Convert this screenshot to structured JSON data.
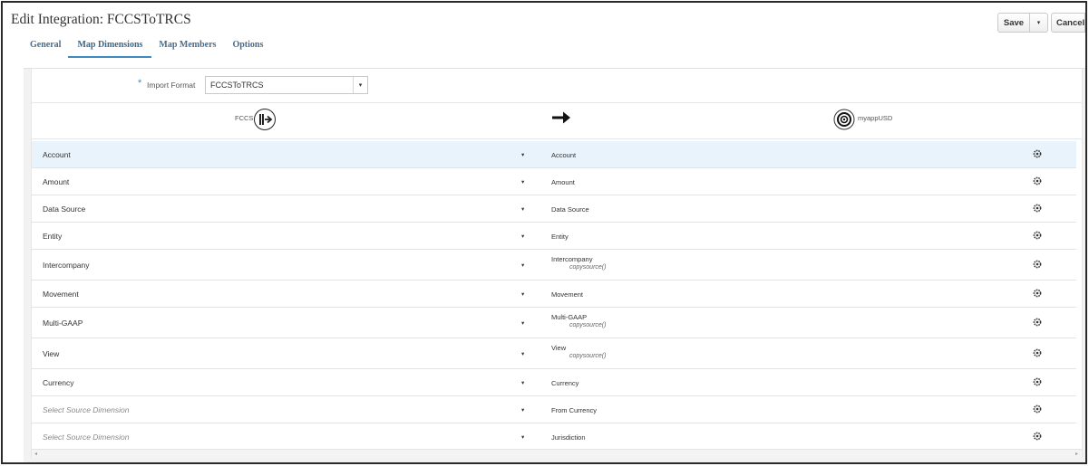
{
  "page": {
    "title": "Edit Integration: FCCSToTRCS"
  },
  "toolbar": {
    "save_label": "Save",
    "cancel_label": "Cancel",
    "dropdown_glyph": "▾"
  },
  "tabs": [
    {
      "label": "General",
      "active": false
    },
    {
      "label": "Map Dimensions",
      "active": true
    },
    {
      "label": "Map Members",
      "active": false
    },
    {
      "label": "Options",
      "active": false
    }
  ],
  "import_format": {
    "required_mark": "*",
    "label": "Import Format",
    "value": "FCCSToTRCS",
    "caret": "▾"
  },
  "mapping_header": {
    "source_label": "FCCS",
    "target_label": "myappUSD"
  },
  "row_caret": "▾",
  "rows": [
    {
      "source": "Account",
      "source_placeholder": false,
      "target": "Account",
      "expression": "",
      "selected": true
    },
    {
      "source": "Amount",
      "source_placeholder": false,
      "target": "Amount",
      "expression": "",
      "selected": false
    },
    {
      "source": "Data Source",
      "source_placeholder": false,
      "target": "Data Source",
      "expression": "",
      "selected": false
    },
    {
      "source": "Entity",
      "source_placeholder": false,
      "target": "Entity",
      "expression": "",
      "selected": false
    },
    {
      "source": "Intercompany",
      "source_placeholder": false,
      "target": "Intercompany",
      "expression": "copysource()",
      "selected": false
    },
    {
      "source": "Movement",
      "source_placeholder": false,
      "target": "Movement",
      "expression": "",
      "selected": false
    },
    {
      "source": "Multi-GAAP",
      "source_placeholder": false,
      "target": "Multi-GAAP",
      "expression": "copysource()",
      "selected": false
    },
    {
      "source": "View",
      "source_placeholder": false,
      "target": "View",
      "expression": "copysource()",
      "selected": false
    },
    {
      "source": "Currency",
      "source_placeholder": false,
      "target": "Currency",
      "expression": "",
      "selected": false
    },
    {
      "source": "Select Source Dimension",
      "source_placeholder": true,
      "target": "From Currency",
      "expression": "",
      "selected": false
    },
    {
      "source": "Select Source Dimension",
      "source_placeholder": true,
      "target": "Jurisdiction",
      "expression": "",
      "selected": false
    }
  ],
  "icons": {
    "source_app": "source-app-icon",
    "arrow": "arrow-right-icon",
    "target_app": "target-app-icon",
    "row_action": "gear-icon"
  },
  "colors": {
    "accent": "#3f8ac0",
    "selected_row": "#e9f3fb",
    "tab_text": "#4a6b8a"
  }
}
